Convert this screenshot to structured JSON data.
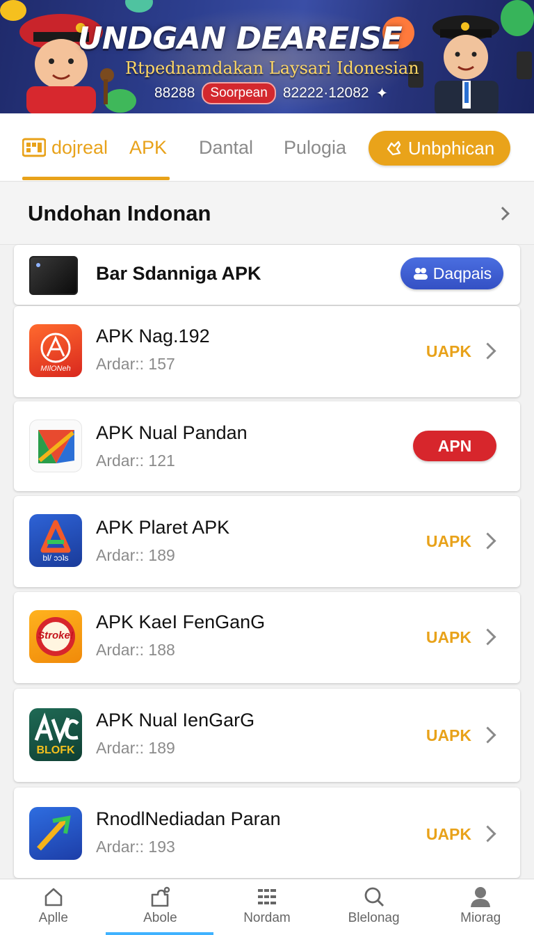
{
  "banner": {
    "title": "UNDGAN DEAREISE",
    "subtitle": "Rtpednamdakan Laysari Idonesian",
    "left_number": "88288",
    "pill": "Soorpean",
    "right_number": "82222·12082"
  },
  "tabs": [
    {
      "label": "dojreal"
    },
    {
      "label": "APK"
    },
    {
      "label": "Dantal"
    },
    {
      "label": "Pulogia"
    }
  ],
  "cta": {
    "label": "Unbphican"
  },
  "section": {
    "title": "Undohan Indonan"
  },
  "featured": {
    "name": "Bar Sdanniga APK",
    "button": "Daqpais"
  },
  "apps": [
    {
      "name": "APK Nag.192",
      "meta": "Ardar:: 157",
      "action": "UAPK",
      "icon_label": "MIlONeh"
    },
    {
      "name": "APK Nual Pandan",
      "meta": "Ardar:: 121",
      "action": "APN"
    },
    {
      "name": "APK Plaret APK",
      "meta": "Ardar:: 189",
      "action": "UAPK",
      "icon_label": "bl/ ɔɔʇs"
    },
    {
      "name": "APK KaeI FenGanG",
      "meta": "Ardar:: 188",
      "action": "UAPK",
      "icon_label": "Stroke!"
    },
    {
      "name": "APK Nual ΙenGarG",
      "meta": "Ardar:: 189",
      "action": "UAPK",
      "icon_label": "BLOFK"
    },
    {
      "name": "RnodlNediadan Paran",
      "meta": "Ardar:: 193",
      "action": "UAPK"
    }
  ],
  "bottom_nav": [
    {
      "label": "Aplle",
      "icon": "home-icon"
    },
    {
      "label": "Abole",
      "icon": "puzzle-icon"
    },
    {
      "label": "Nordam",
      "icon": "list-icon"
    },
    {
      "label": "Blelonag",
      "icon": "search-icon"
    },
    {
      "label": "Miorag",
      "icon": "user-icon"
    }
  ],
  "colors": {
    "accent": "#e8a21a",
    "red": "#d7262c",
    "blue": "#3a5bd0"
  }
}
